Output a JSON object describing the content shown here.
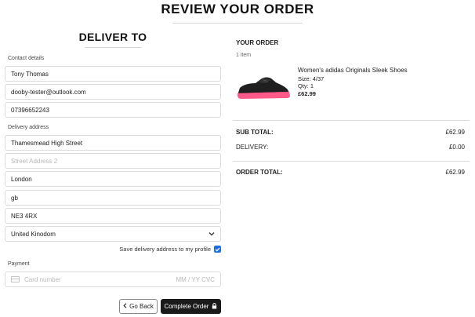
{
  "page": {
    "title": "REVIEW YOUR ORDER"
  },
  "delivery": {
    "heading": "DELIVER TO",
    "contact_label": "Contact details",
    "name": "Tony Thomas",
    "email": "dooby-tester@outlook.com",
    "phone": "07396652243",
    "address_label": "Delivery address",
    "street1": "Thamesmead High Street",
    "street2_placeholder": "Street Address 2",
    "city": "London",
    "region": "gb",
    "postcode": "NE3 4RX",
    "country": "United Kinodom",
    "save_label": "Save delivery address to my profile",
    "save_checked": true
  },
  "payment": {
    "label": "Payment",
    "card_placeholder": "Card number",
    "exp_placeholder": "MM / YY  CVC"
  },
  "buttons": {
    "back_label": "Go Back",
    "complete_label": "Complete Order"
  },
  "order": {
    "heading": "YOUR ORDER",
    "item_count": "1 item",
    "item": {
      "name": "Women's adidas Originals Sleek Shoes",
      "size": "Size: 4/37",
      "qty": "Qty: 1",
      "price": "£62.99"
    },
    "subtotal_label": "SUB TOTAL:",
    "subtotal_value": "£62.99",
    "delivery_label": "DELIVERY:",
    "delivery_value": "£0.00",
    "total_label": "ORDER TOTAL:",
    "total_value": "£62.99"
  },
  "icons": {
    "back": "chevron-left-icon",
    "lock": "lock-icon",
    "card": "credit-card-icon",
    "select": "chevron-down-icon",
    "checkbox": "checkmark-icon"
  },
  "colors": {
    "accent": "#1e6fe0",
    "complete_button": "#1a1a1a",
    "shoe_sole": "#ff5a8a"
  }
}
